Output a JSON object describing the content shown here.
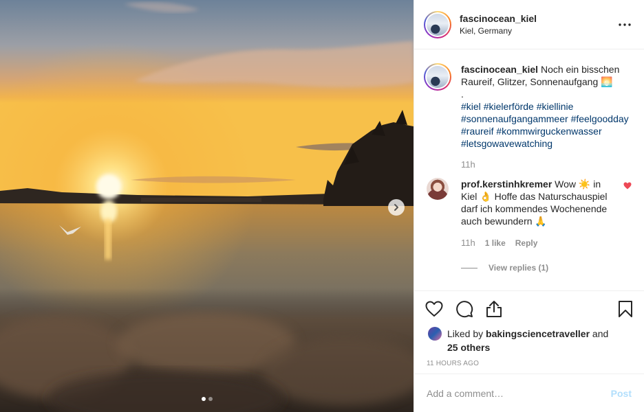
{
  "post": {
    "username": "fascinocean_kiel",
    "location": "Kiel, Germany",
    "more_label": "•••",
    "caption": {
      "text_line1": "Noch ein bisschen",
      "text_line2": "Raureif, Glitzer, Sonnenaufgang",
      "emoji_sunrise": "🌅",
      "dot": ".",
      "hashtags": [
        "#kiel",
        "#kielerförde",
        "#kiellinie",
        "#sonnenaufgangammeer",
        "#feelgoodday",
        "#raureif",
        "#kommwirguckenwasser",
        "#letsgowavewatching"
      ],
      "time": "11h"
    },
    "comment": {
      "username": "prof.kerstinhkremer",
      "text_a": "Wow",
      "emoji_sun": "☀️",
      "text_b": "in",
      "text_c": "Kiel",
      "emoji_hand": "👌",
      "text_d": "Hoffe das Naturschauspiel darf ich kommendes Wochenende auch bewundern",
      "emoji_pray": "🙏",
      "time": "11h",
      "likes": "1 like",
      "reply": "Reply",
      "view_replies": "View replies (1)"
    },
    "likes": {
      "prefix": "Liked by",
      "user": "bakingsciencetraveller",
      "and": "and",
      "others": "25 others"
    },
    "timestamp": "11 HOURS AGO",
    "add_comment_placeholder": "Add a comment…",
    "post_button": "Post",
    "carousel": {
      "count": 2,
      "active": 0
    }
  },
  "colors": {
    "link": "#00376b",
    "muted": "#8e8e8e",
    "heart": "#ed4956",
    "post_disabled": "#b2dffc"
  },
  "icons": [
    "ellipsis-icon",
    "chevron-right-icon",
    "heart-icon",
    "comment-icon",
    "share-icon",
    "bookmark-icon",
    "small-heart-icon"
  ]
}
